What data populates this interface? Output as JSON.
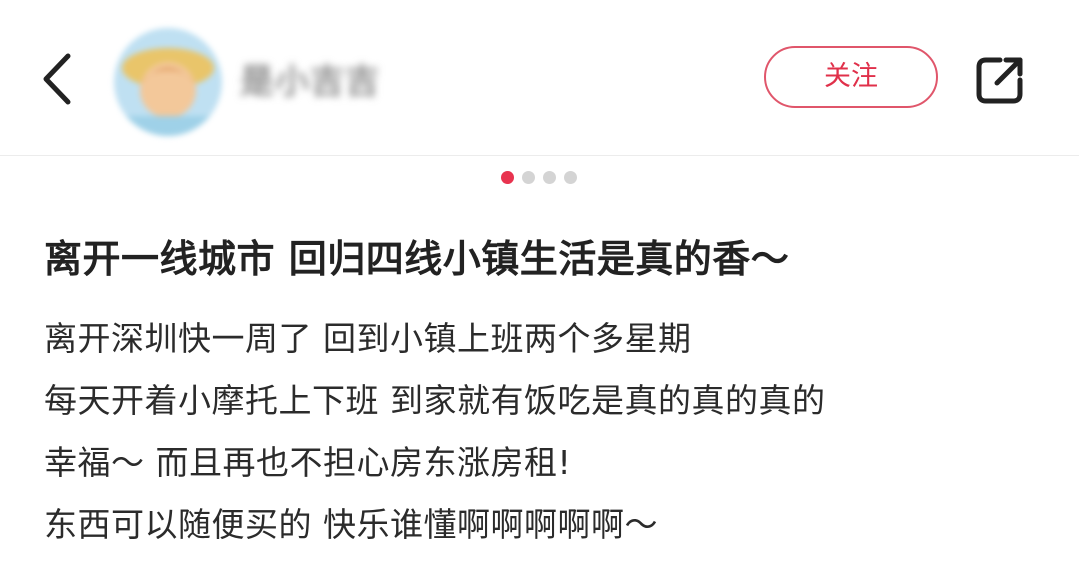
{
  "header": {
    "username": "是小吉吉",
    "follow_label": "关注",
    "back_icon": "chevron-left-icon",
    "share_icon": "share-icon"
  },
  "carousel": {
    "count": 4,
    "active_index": 0
  },
  "post": {
    "title": "离开一线城市 回归四线小镇生活是真的香～",
    "body_lines": [
      "离开深圳快一周了 回到小镇上班两个多星期",
      "每天开着小摩托上下班 到家就有饭吃是真的真的真的",
      "幸福～ 而且再也不担心房东涨房租!",
      "东西可以随便买的 快乐谁懂啊啊啊啊啊～"
    ]
  },
  "colors": {
    "accent": "#e0304a",
    "dot_active": "#e8334f",
    "dot_inactive": "#d4d4d4"
  }
}
